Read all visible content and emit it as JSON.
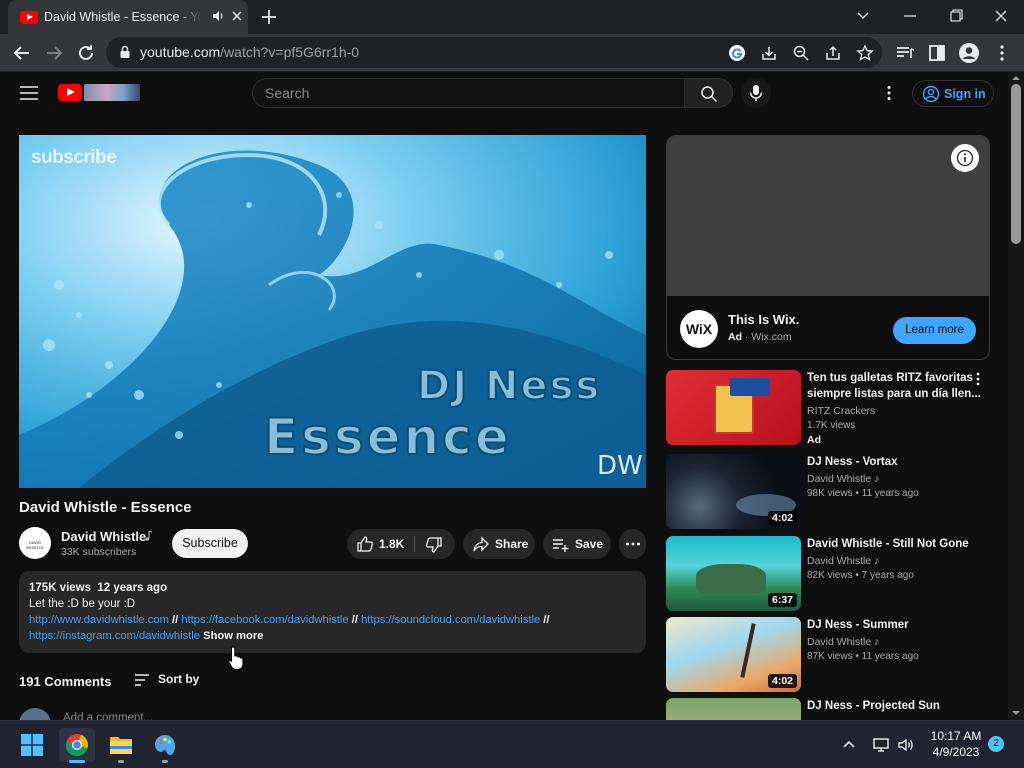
{
  "browser": {
    "tab_title": "David Whistle - Essence - YouTube",
    "url_host": "youtube.com",
    "url_path": "/watch?v=pf5G6rr1h-0"
  },
  "header": {
    "search_placeholder": "Search",
    "sign_in": "Sign in"
  },
  "player": {
    "watermark": "subscribe",
    "artist_art": "DJ Ness",
    "track_art": "Essence",
    "logo_art": "DW"
  },
  "video": {
    "title": "David Whistle - Essence",
    "channel": "David Whistle",
    "avatar_text": "DAVID WHISTLE",
    "subscribers": "33K subscribers",
    "subscribe_label": "Subscribe",
    "likes": "1.8K",
    "share_label": "Share",
    "save_label": "Save",
    "views": "175K views",
    "age": "12 years ago",
    "description_line": "Let the :D be your :D",
    "links": [
      "http://www.davidwhistle.com",
      "https://facebook.com/davidwhistle",
      "https://soundcloud.com/davidwhistle",
      "https://instagram.com/davidwhistle"
    ],
    "link_separator": "//",
    "show_more": "Show more"
  },
  "comments": {
    "count_label": "191 Comments",
    "sort_label": "Sort by",
    "add_placeholder": "Add a comment..."
  },
  "ad": {
    "title": "This Is Wix.",
    "badge": "Ad",
    "domain": "Wix.com",
    "logo_text": "WiX",
    "cta": "Learn more"
  },
  "recommendations": [
    {
      "title": "Ten tus galletas RITZ favoritas siempre listas para un día llen...",
      "channel": "RITZ Crackers",
      "meta": "1.7K views",
      "badge": "Ad",
      "duration": ""
    },
    {
      "title": "DJ Ness - Vortax",
      "channel": "David Whistle",
      "views": "98K views",
      "age": "11 years ago",
      "duration": "4:02"
    },
    {
      "title": "David Whistle - Still Not Gone",
      "channel": "David Whistle",
      "views": "82K views",
      "age": "7 years ago",
      "duration": "6:37"
    },
    {
      "title": "DJ Ness - Summer",
      "channel": "David Whistle",
      "views": "87K views",
      "age": "11 years ago",
      "duration": "4:02"
    },
    {
      "title": "DJ Ness - Projected Sun",
      "channel": "",
      "views": "",
      "age": "",
      "duration": ""
    }
  ],
  "taskbar": {
    "time": "10:17 AM",
    "date": "4/9/2023",
    "notifications": "2"
  },
  "colors": {
    "brand_red": "#ff0000",
    "link_blue": "#3ea6ff",
    "background": "#0f0f0f"
  }
}
